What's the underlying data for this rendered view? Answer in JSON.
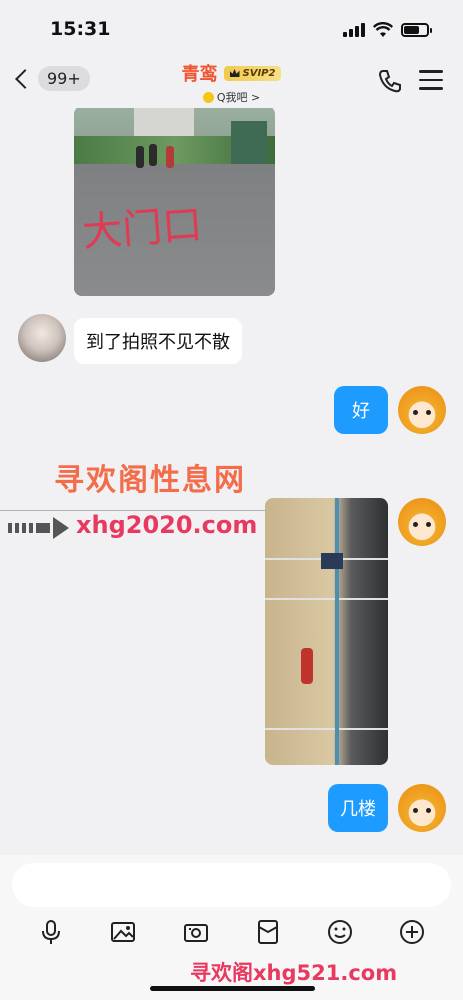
{
  "status_bar": {
    "time": "15:31"
  },
  "header": {
    "unread_count": "99+",
    "contact_name": "青鸾",
    "vip_label": "SVIP2",
    "subtitle": "Q我吧 >"
  },
  "messages": [
    {
      "type": "image",
      "side": "in",
      "caption": "大门口"
    },
    {
      "type": "text",
      "side": "in",
      "text": "到了拍照不见不散"
    },
    {
      "type": "text",
      "side": "out",
      "text": "好"
    },
    {
      "type": "image",
      "side": "out"
    },
    {
      "type": "text",
      "side": "out",
      "text": "几楼"
    }
  ],
  "overlay_watermark": {
    "title": "寻欢阁性息网",
    "url": "xhg2020.com"
  },
  "input": {
    "placeholder": ""
  },
  "toolbar_icons": [
    "microphone-icon",
    "photo-icon",
    "camera-icon",
    "red-packet-icon",
    "emoji-icon",
    "plus-icon"
  ],
  "footer_watermark": "寻欢阁xhg521.com",
  "colors": {
    "accent": "#1e9bff",
    "name": "#f0552f",
    "watermark": "#e8395f"
  }
}
